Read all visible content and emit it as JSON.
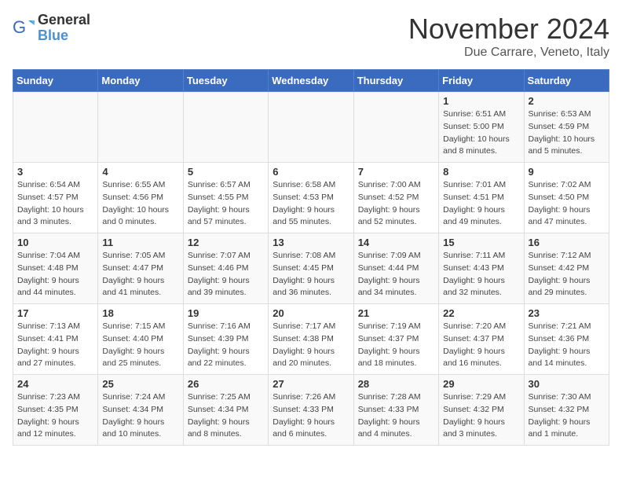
{
  "logo": {
    "text_general": "General",
    "text_blue": "Blue"
  },
  "title": "November 2024",
  "subtitle": "Due Carrare, Veneto, Italy",
  "days_of_week": [
    "Sunday",
    "Monday",
    "Tuesday",
    "Wednesday",
    "Thursday",
    "Friday",
    "Saturday"
  ],
  "weeks": [
    [
      {
        "day": "",
        "info": ""
      },
      {
        "day": "",
        "info": ""
      },
      {
        "day": "",
        "info": ""
      },
      {
        "day": "",
        "info": ""
      },
      {
        "day": "",
        "info": ""
      },
      {
        "day": "1",
        "info": "Sunrise: 6:51 AM\nSunset: 5:00 PM\nDaylight: 10 hours and 8 minutes."
      },
      {
        "day": "2",
        "info": "Sunrise: 6:53 AM\nSunset: 4:59 PM\nDaylight: 10 hours and 5 minutes."
      }
    ],
    [
      {
        "day": "3",
        "info": "Sunrise: 6:54 AM\nSunset: 4:57 PM\nDaylight: 10 hours and 3 minutes."
      },
      {
        "day": "4",
        "info": "Sunrise: 6:55 AM\nSunset: 4:56 PM\nDaylight: 10 hours and 0 minutes."
      },
      {
        "day": "5",
        "info": "Sunrise: 6:57 AM\nSunset: 4:55 PM\nDaylight: 9 hours and 57 minutes."
      },
      {
        "day": "6",
        "info": "Sunrise: 6:58 AM\nSunset: 4:53 PM\nDaylight: 9 hours and 55 minutes."
      },
      {
        "day": "7",
        "info": "Sunrise: 7:00 AM\nSunset: 4:52 PM\nDaylight: 9 hours and 52 minutes."
      },
      {
        "day": "8",
        "info": "Sunrise: 7:01 AM\nSunset: 4:51 PM\nDaylight: 9 hours and 49 minutes."
      },
      {
        "day": "9",
        "info": "Sunrise: 7:02 AM\nSunset: 4:50 PM\nDaylight: 9 hours and 47 minutes."
      }
    ],
    [
      {
        "day": "10",
        "info": "Sunrise: 7:04 AM\nSunset: 4:48 PM\nDaylight: 9 hours and 44 minutes."
      },
      {
        "day": "11",
        "info": "Sunrise: 7:05 AM\nSunset: 4:47 PM\nDaylight: 9 hours and 41 minutes."
      },
      {
        "day": "12",
        "info": "Sunrise: 7:07 AM\nSunset: 4:46 PM\nDaylight: 9 hours and 39 minutes."
      },
      {
        "day": "13",
        "info": "Sunrise: 7:08 AM\nSunset: 4:45 PM\nDaylight: 9 hours and 36 minutes."
      },
      {
        "day": "14",
        "info": "Sunrise: 7:09 AM\nSunset: 4:44 PM\nDaylight: 9 hours and 34 minutes."
      },
      {
        "day": "15",
        "info": "Sunrise: 7:11 AM\nSunset: 4:43 PM\nDaylight: 9 hours and 32 minutes."
      },
      {
        "day": "16",
        "info": "Sunrise: 7:12 AM\nSunset: 4:42 PM\nDaylight: 9 hours and 29 minutes."
      }
    ],
    [
      {
        "day": "17",
        "info": "Sunrise: 7:13 AM\nSunset: 4:41 PM\nDaylight: 9 hours and 27 minutes."
      },
      {
        "day": "18",
        "info": "Sunrise: 7:15 AM\nSunset: 4:40 PM\nDaylight: 9 hours and 25 minutes."
      },
      {
        "day": "19",
        "info": "Sunrise: 7:16 AM\nSunset: 4:39 PM\nDaylight: 9 hours and 22 minutes."
      },
      {
        "day": "20",
        "info": "Sunrise: 7:17 AM\nSunset: 4:38 PM\nDaylight: 9 hours and 20 minutes."
      },
      {
        "day": "21",
        "info": "Sunrise: 7:19 AM\nSunset: 4:37 PM\nDaylight: 9 hours and 18 minutes."
      },
      {
        "day": "22",
        "info": "Sunrise: 7:20 AM\nSunset: 4:37 PM\nDaylight: 9 hours and 16 minutes."
      },
      {
        "day": "23",
        "info": "Sunrise: 7:21 AM\nSunset: 4:36 PM\nDaylight: 9 hours and 14 minutes."
      }
    ],
    [
      {
        "day": "24",
        "info": "Sunrise: 7:23 AM\nSunset: 4:35 PM\nDaylight: 9 hours and 12 minutes."
      },
      {
        "day": "25",
        "info": "Sunrise: 7:24 AM\nSunset: 4:34 PM\nDaylight: 9 hours and 10 minutes."
      },
      {
        "day": "26",
        "info": "Sunrise: 7:25 AM\nSunset: 4:34 PM\nDaylight: 9 hours and 8 minutes."
      },
      {
        "day": "27",
        "info": "Sunrise: 7:26 AM\nSunset: 4:33 PM\nDaylight: 9 hours and 6 minutes."
      },
      {
        "day": "28",
        "info": "Sunrise: 7:28 AM\nSunset: 4:33 PM\nDaylight: 9 hours and 4 minutes."
      },
      {
        "day": "29",
        "info": "Sunrise: 7:29 AM\nSunset: 4:32 PM\nDaylight: 9 hours and 3 minutes."
      },
      {
        "day": "30",
        "info": "Sunrise: 7:30 AM\nSunset: 4:32 PM\nDaylight: 9 hours and 1 minute."
      }
    ]
  ]
}
